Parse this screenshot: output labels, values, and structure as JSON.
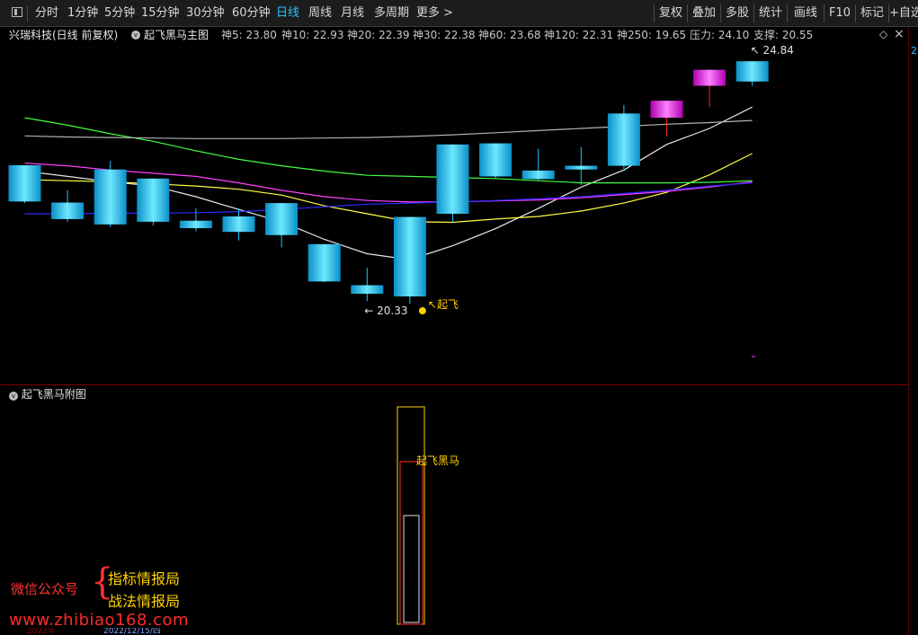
{
  "toolbar": {
    "periods": [
      "分时",
      "1分钟",
      "5分钟",
      "15分钟",
      "30分钟",
      "60分钟",
      "日线",
      "周线",
      "月线",
      "多周期",
      "更多 >"
    ],
    "active_period": "日线",
    "right_buttons": [
      "复权",
      "叠加",
      "多股",
      "统计",
      "画线",
      "F10",
      "标记",
      "+自选"
    ]
  },
  "info": {
    "title": "兴瑞科技(日线 前复权)",
    "indicator": "起飞黑马主图",
    "ma": [
      {
        "label": "神5: 23.80",
        "color": "#e6e6e6"
      },
      {
        "label": "神10: 22.93",
        "color": "#ffff40"
      },
      {
        "label": "神20: 22.39",
        "color": "#ff40ff"
      },
      {
        "label": "神30: 22.38",
        "color": "#40ff40"
      },
      {
        "label": "神60: 23.68",
        "color": "#b0b0b0"
      },
      {
        "label": "神120: 22.31",
        "color": "#2a2aff"
      },
      {
        "label": "神250: 19.65",
        "color": "#ff40ff"
      },
      {
        "label": "压力: 24.10",
        "color": "#ffff40"
      },
      {
        "label": "支撑: 20.55",
        "color": "#40ff40"
      }
    ]
  },
  "scroll_label": "2",
  "chart_data": {
    "type": "candlestick",
    "indicator": "起飞黑马主图",
    "ylim": [
      19.0,
      25.4
    ],
    "up_color": "#ff30ff",
    "down_color": "#18c8ff",
    "series": [
      {
        "o": 23.11,
        "h": 23.11,
        "l": 22.4,
        "c": 22.43
      },
      {
        "o": 22.41,
        "h": 22.64,
        "l": 22.05,
        "c": 22.1
      },
      {
        "o": 23.03,
        "h": 23.19,
        "l": 21.95,
        "c": 22.0
      },
      {
        "o": 22.86,
        "h": 22.86,
        "l": 21.98,
        "c": 22.05
      },
      {
        "o": 22.07,
        "h": 22.3,
        "l": 21.87,
        "c": 21.93
      },
      {
        "o": 22.15,
        "h": 22.3,
        "l": 21.7,
        "c": 21.86
      },
      {
        "o": 22.4,
        "h": 22.4,
        "l": 21.57,
        "c": 21.8
      },
      {
        "o": 21.63,
        "h": 21.63,
        "l": 20.92,
        "c": 20.93
      },
      {
        "o": 20.86,
        "h": 21.19,
        "l": 20.56,
        "c": 20.7
      },
      {
        "o": 22.14,
        "h": 22.14,
        "l": 20.51,
        "c": 20.65
      },
      {
        "o": 23.5,
        "h": 23.5,
        "l": 22.04,
        "c": 22.2
      },
      {
        "o": 23.52,
        "h": 23.52,
        "l": 22.85,
        "c": 22.9
      },
      {
        "o": 23.01,
        "h": 23.42,
        "l": 22.82,
        "c": 22.85
      },
      {
        "o": 23.1,
        "h": 23.45,
        "l": 22.74,
        "c": 23.03
      },
      {
        "o": 24.08,
        "h": 24.24,
        "l": 23.0,
        "c": 23.1
      },
      {
        "o": 24.0,
        "h": 24.32,
        "l": 23.65,
        "c": 24.32
      },
      {
        "o": 24.6,
        "h": 24.9,
        "l": 24.2,
        "c": 24.9
      },
      {
        "o": 25.06,
        "h": 25.06,
        "l": 24.6,
        "c": 24.68
      }
    ],
    "lines": [
      {
        "name": "神5",
        "color": "#e6e6e6",
        "values": [
          23.0,
          22.9,
          22.8,
          22.72,
          22.52,
          22.28,
          22.05,
          21.72,
          21.45,
          21.34,
          21.6,
          21.92,
          22.3,
          22.7,
          23.02,
          23.5,
          23.8,
          24.2
        ]
      },
      {
        "name": "神10",
        "color": "#ffff40",
        "values": [
          22.84,
          22.82,
          22.8,
          22.76,
          22.72,
          22.66,
          22.55,
          22.35,
          22.2,
          22.05,
          22.04,
          22.1,
          22.15,
          22.25,
          22.4,
          22.6,
          22.93,
          23.33
        ]
      },
      {
        "name": "神20",
        "color": "#ff40ff",
        "values": [
          23.15,
          23.1,
          23.02,
          22.96,
          22.9,
          22.78,
          22.64,
          22.52,
          22.45,
          22.42,
          22.42,
          22.44,
          22.46,
          22.5,
          22.56,
          22.62,
          22.7,
          22.8
        ]
      },
      {
        "name": "神30",
        "color": "#40ff40",
        "values": [
          24.0,
          23.86,
          23.7,
          23.56,
          23.38,
          23.22,
          23.1,
          23.0,
          22.92,
          22.9,
          22.88,
          22.86,
          22.82,
          22.78,
          22.78,
          22.78,
          22.79,
          22.82
        ]
      },
      {
        "name": "神60",
        "color": "#b0b0b0",
        "values": [
          23.66,
          23.64,
          23.63,
          23.62,
          23.61,
          23.61,
          23.61,
          23.62,
          23.63,
          23.65,
          23.68,
          23.72,
          23.76,
          23.8,
          23.84,
          23.88,
          23.91,
          23.95
        ]
      },
      {
        "name": "神120",
        "color": "#2a2aff",
        "values": [
          22.2,
          22.2,
          22.21,
          22.21,
          22.22,
          22.24,
          22.28,
          22.33,
          22.38,
          22.4,
          22.42,
          22.45,
          22.48,
          22.52,
          22.58,
          22.64,
          22.72,
          22.78
        ]
      }
    ],
    "annotations": {
      "low_label": "20.33",
      "high_label": "24.84",
      "signal_label": "起飞"
    },
    "sub": {
      "title": "起飞黑马附图",
      "signal_label": "起飞黑马"
    }
  },
  "watermark": {
    "line1": "微信公众号",
    "line2": "指标情报局",
    "line3": "战法情报局",
    "url": "www.zhibiao168.com"
  },
  "datebar": {
    "left": "2022年",
    "center": "2022/12/15/四"
  }
}
